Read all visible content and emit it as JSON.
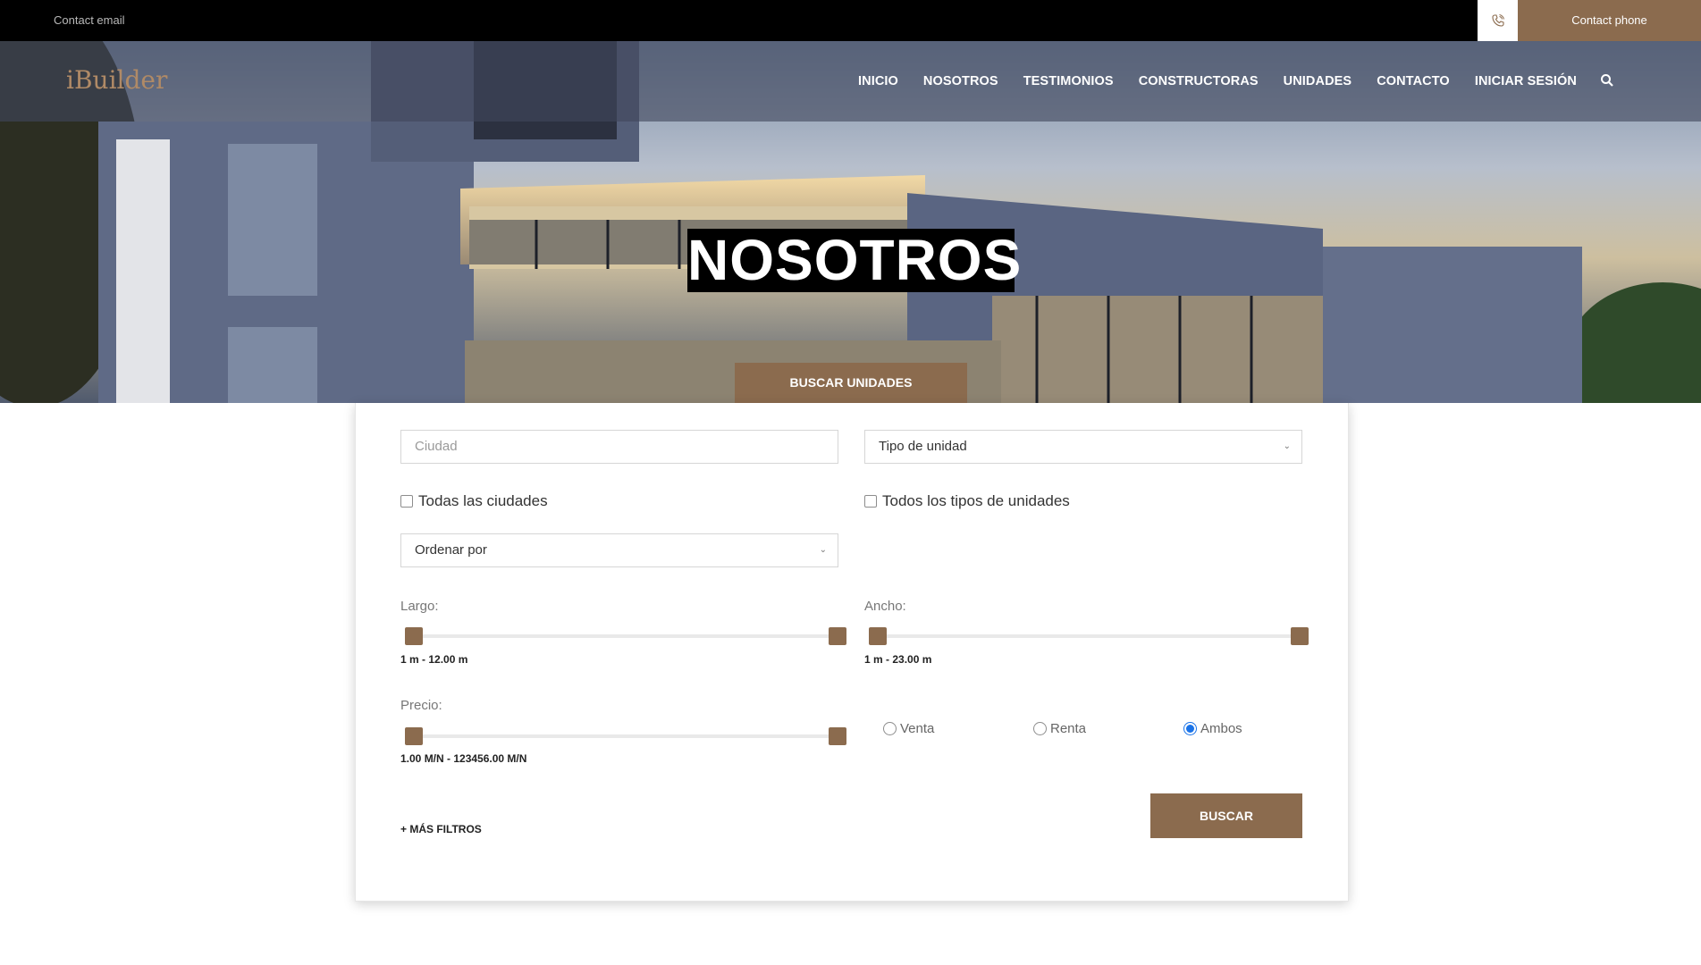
{
  "topbar": {
    "contact_email": "Contact email",
    "contact_phone": "Contact phone"
  },
  "navbar": {
    "logo": "iBuilder",
    "items": [
      "INICIO",
      "NOSOTROS",
      "TESTIMONIOS",
      "CONSTRUCTORAS",
      "UNIDADES",
      "CONTACTO",
      "INICIAR SESIÓN"
    ]
  },
  "hero": {
    "title": "NOSOTROS",
    "search_tab": "BUSCAR UNIDADES"
  },
  "search_form": {
    "city_placeholder": "Ciudad",
    "unit_type_select": "Tipo de unidad",
    "all_cities_label": "Todas las ciudades",
    "all_unit_types_label": "Todos los tipos de unidades",
    "order_select": "Ordenar por",
    "largo": {
      "label": "Largo:",
      "range_text": "1 m - 12.00 m",
      "min": 1,
      "max": 12.0
    },
    "ancho": {
      "label": "Ancho:",
      "range_text": "1 m - 23.00 m",
      "min": 1,
      "max": 23.0
    },
    "precio": {
      "label": "Precio:",
      "range_text": "1.00 M/N - 123456.00 M/N",
      "min": 1.0,
      "max": 123456.0
    },
    "operation_options": [
      {
        "label": "Venta",
        "checked": false
      },
      {
        "label": "Renta",
        "checked": false
      },
      {
        "label": "Ambos",
        "checked": true
      }
    ],
    "more_filters": "+ MÁS FILTROS",
    "search_button": "BUSCAR"
  },
  "colors": {
    "accent": "#8b6b4e",
    "topbar": "#000000",
    "radio_checked": "#1a73e8"
  },
  "icons": [
    "phone-icon",
    "search-icon",
    "chevron-down-icon"
  ]
}
